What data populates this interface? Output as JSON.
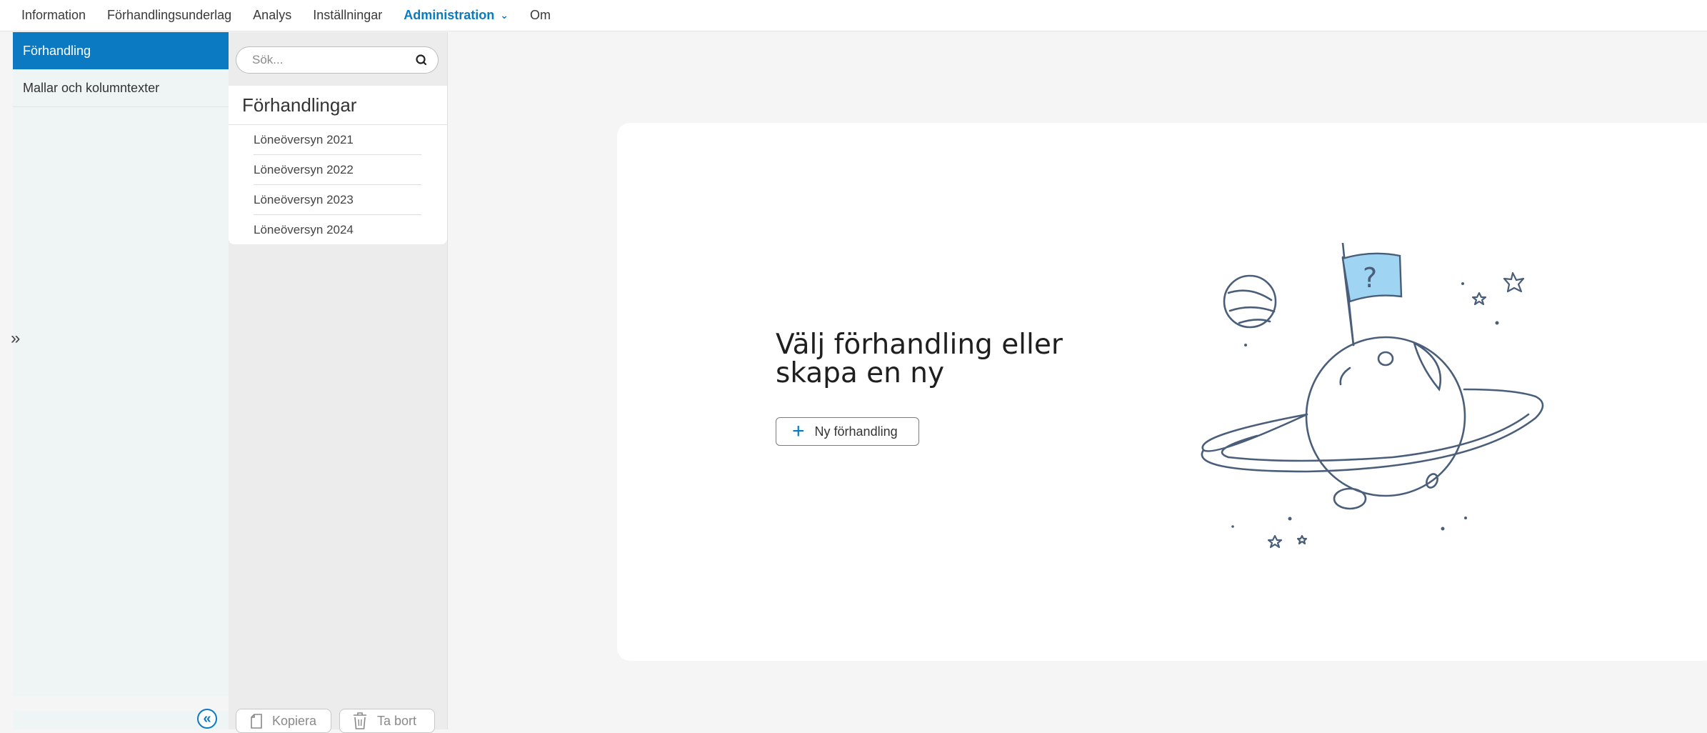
{
  "topnav": {
    "items": [
      {
        "label": "Information"
      },
      {
        "label": "Förhandlingsunderlag"
      },
      {
        "label": "Analys"
      },
      {
        "label": "Inställningar"
      },
      {
        "label": "Administration",
        "active": true
      },
      {
        "label": "Om"
      }
    ],
    "active_color": "#0a7bc1"
  },
  "sidebar": {
    "items": [
      {
        "label": "Förhandling",
        "active": true
      },
      {
        "label": "Mallar och kolumntexter"
      }
    ],
    "expand_icon": "double-chevron-right-icon",
    "collapse_icon": "double-chevron-left-icon",
    "accent": "#0b7ac2"
  },
  "list": {
    "search_placeholder": "Sök...",
    "title": "Förhandlingar",
    "items": [
      {
        "label": "Löneöversyn 2021"
      },
      {
        "label": "Löneöversyn 2022"
      },
      {
        "label": "Löneöversyn 2023"
      },
      {
        "label": "Löneöversyn 2024"
      }
    ],
    "copy_label": "Kopiera",
    "delete_label": "Ta bort"
  },
  "main": {
    "heading": "Välj förhandling eller skapa en ny",
    "new_button_label": "Ny förhandling",
    "illustration": "planet-with-question-flag"
  }
}
